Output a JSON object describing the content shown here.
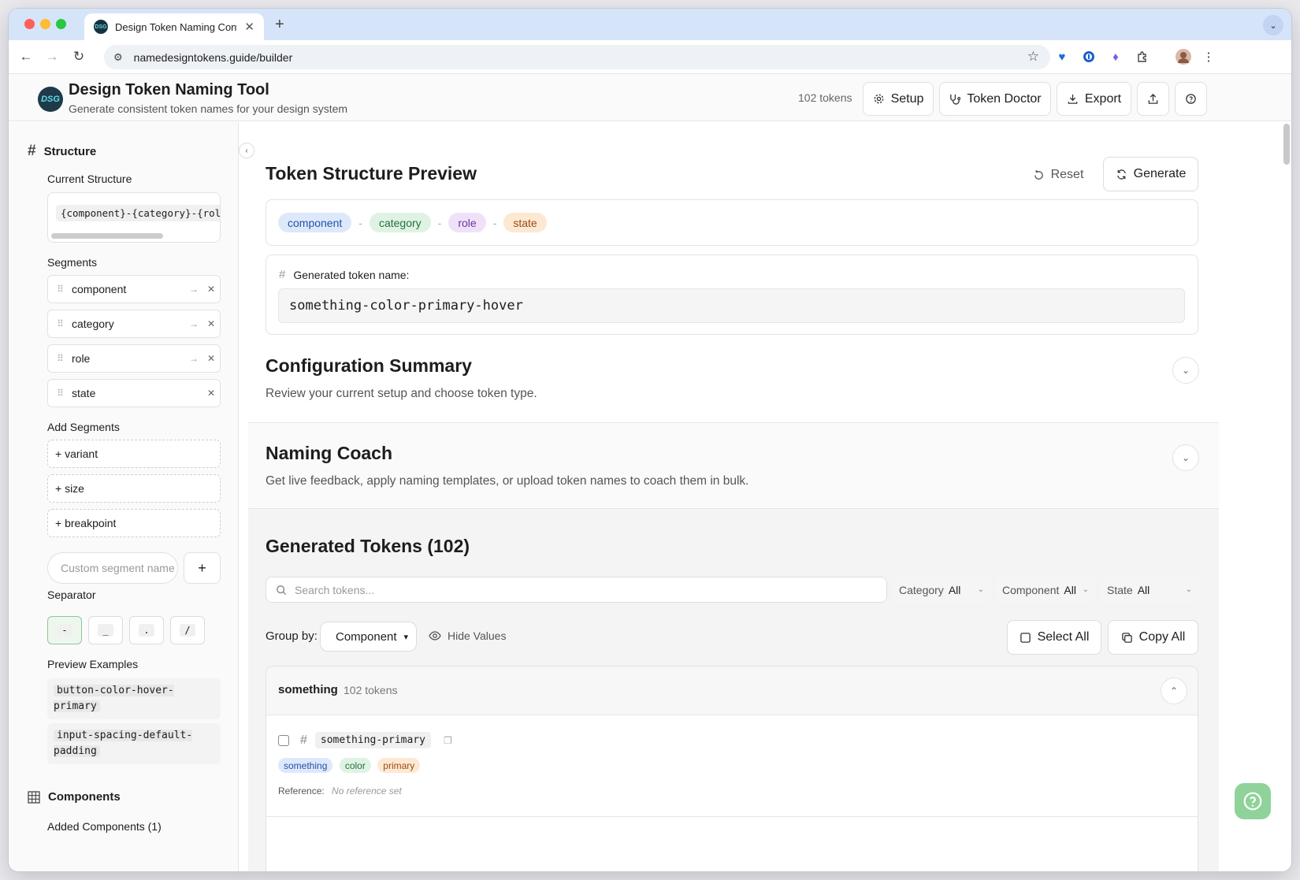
{
  "browser": {
    "tab_title": "Design Token Naming Conver",
    "url": "namedesigntokens.guide/builder"
  },
  "header": {
    "logo_text": "DSG",
    "title": "Design Token Naming Tool",
    "subtitle": "Generate consistent token names for your design system",
    "token_count": "102 tokens",
    "setup_label": "Setup",
    "doctor_label": "Token Doctor",
    "export_label": "Export"
  },
  "sidebar": {
    "structure_title": "Structure",
    "current_structure_label": "Current Structure",
    "current_structure_value": "{component}-{category}-{role}-{state}",
    "segments_label": "Segments",
    "segments": [
      {
        "name": "component"
      },
      {
        "name": "category"
      },
      {
        "name": "role"
      },
      {
        "name": "state"
      }
    ],
    "add_segments_label": "Add Segments",
    "add_segments": [
      "+ variant",
      "+ size",
      "+ breakpoint"
    ],
    "custom_placeholder": "Custom segment name",
    "add_button": "+",
    "separator_label": "Separator",
    "separators": [
      "-",
      "_",
      ".",
      "/"
    ],
    "preview_label": "Preview Examples",
    "preview_examples": [
      "button-color-hover-primary",
      "input-spacing-default-padding"
    ],
    "components_title": "Components",
    "added_components": "Added Components (1)"
  },
  "preview": {
    "title": "Token Structure Preview",
    "reset_label": "Reset",
    "generate_label": "Generate",
    "pills": [
      "component",
      "category",
      "role",
      "state"
    ],
    "separator": "-",
    "generated_label": "Generated token name:",
    "generated_value": "something-color-primary-hover"
  },
  "config": {
    "title": "Configuration Summary",
    "desc": "Review your current setup and choose token type."
  },
  "coach": {
    "title": "Naming Coach",
    "desc": "Get live feedback, apply naming templates, or upload token names to coach them in bulk."
  },
  "tokens": {
    "title": "Generated Tokens (102)",
    "search_placeholder": "Search tokens...",
    "filters": [
      {
        "label": "Category",
        "value": "All"
      },
      {
        "label": "Component",
        "value": "All"
      },
      {
        "label": "State",
        "value": "All"
      }
    ],
    "group_by_label": "Group by:",
    "group_by_value": "Component",
    "hide_values_label": "Hide Values",
    "select_all_label": "Select All",
    "copy_all_label": "Copy All",
    "group": {
      "name": "something",
      "count": "102 tokens",
      "token": {
        "name": "something-primary",
        "tags": [
          "something",
          "color",
          "primary"
        ],
        "reference_label": "Reference:",
        "reference_value": "No reference set"
      }
    }
  },
  "colors": {
    "pill_component_bg": "#dde9fb",
    "pill_component_fg": "#2254a6",
    "pill_category_bg": "#dff3e4",
    "pill_category_fg": "#27703c",
    "pill_role_bg": "#efe2f8",
    "pill_role_fg": "#7232a0",
    "pill_state_bg": "#fde8d3",
    "pill_state_fg": "#9a4d12",
    "fab": "#8fd39a"
  }
}
